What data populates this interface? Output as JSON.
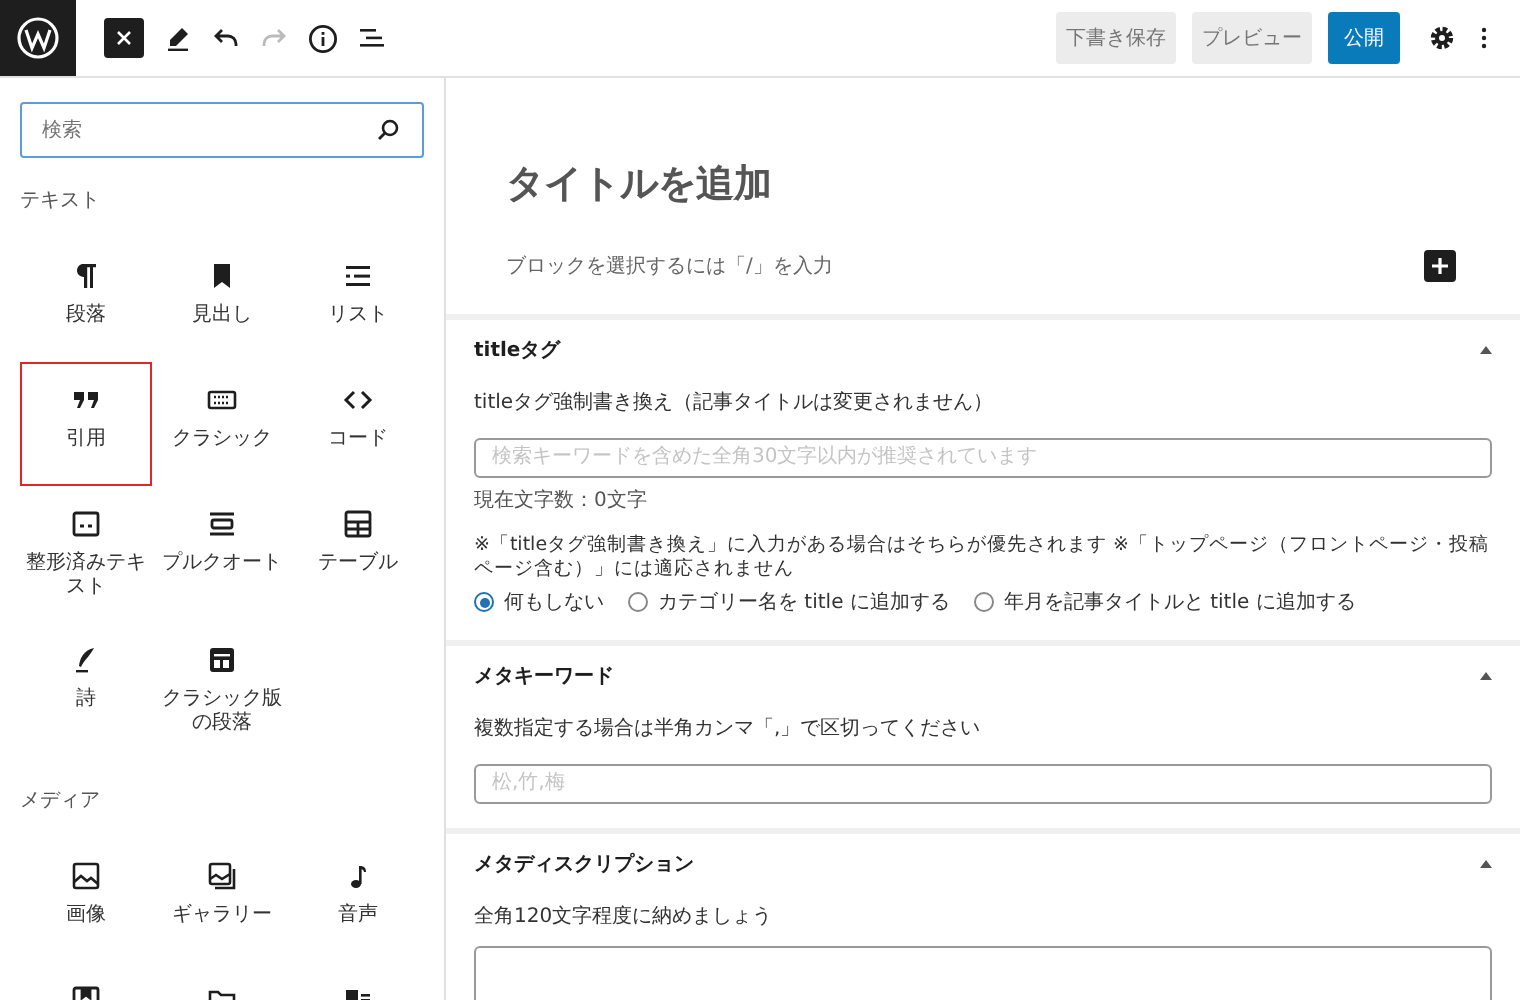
{
  "toolbar": {
    "save_draft": "下書き保存",
    "preview": "プレビュー",
    "publish": "公開",
    "redo_disabled": true
  },
  "inserter": {
    "search": {
      "placeholder": "検索"
    },
    "categories": [
      {
        "label": "テキスト",
        "blocks": [
          {
            "label": "段落",
            "highlighted": false
          },
          {
            "label": "見出し",
            "highlighted": false
          },
          {
            "label": "リスト",
            "highlighted": false
          },
          {
            "label": "引用",
            "highlighted": true
          },
          {
            "label": "クラシック",
            "highlighted": false
          },
          {
            "label": "コード",
            "highlighted": false
          },
          {
            "label": "整形済みテキスト",
            "highlighted": false
          },
          {
            "label": "プルクオート",
            "highlighted": false
          },
          {
            "label": "テーブル",
            "highlighted": false
          },
          {
            "label": "詩",
            "highlighted": false
          },
          {
            "label": "クラシック版の段落",
            "highlighted": false
          }
        ]
      },
      {
        "label": "メディア",
        "blocks": [
          {
            "label": "画像",
            "highlighted": false
          },
          {
            "label": "ギャラリー",
            "highlighted": false
          },
          {
            "label": "音声",
            "highlighted": false
          },
          {
            "highlighted": false
          },
          {
            "highlighted": false
          },
          {
            "highlighted": false
          }
        ]
      }
    ]
  },
  "editor": {
    "title_placeholder": "タイトルを追加",
    "block_hint": "ブロックを選択するには「/」を入力"
  },
  "sections": [
    {
      "kind": "title",
      "title": "titleタグ",
      "expanded": true,
      "description": "titleタグ強制書き換え（記事タイトルは変更されません）",
      "placeholder": "検索キーワードを含めた全角30文字以内が推奨されています",
      "counter": "現在文字数：0文字",
      "note": "※「titleタグ強制書き換え」に入力がある場合はそちらが優先されます ※「トップページ（フロントページ・投稿ページ含む）」には適応されません",
      "options": [
        {
          "label": "何もしない",
          "selected": true
        },
        {
          "label": "カテゴリー名を title に追加する",
          "selected": false
        },
        {
          "label": "年月を記事タイトルと title に追加する",
          "selected": false
        }
      ]
    },
    {
      "kind": "input",
      "title": "メタキーワード",
      "expanded": true,
      "description": "複数指定する場合は半角カンマ「,」で区切ってください",
      "placeholder": "松,竹,梅"
    },
    {
      "kind": "textarea",
      "title": "メタディスクリプション",
      "expanded": true,
      "description": "全角120文字程度に納めましょう"
    }
  ]
}
